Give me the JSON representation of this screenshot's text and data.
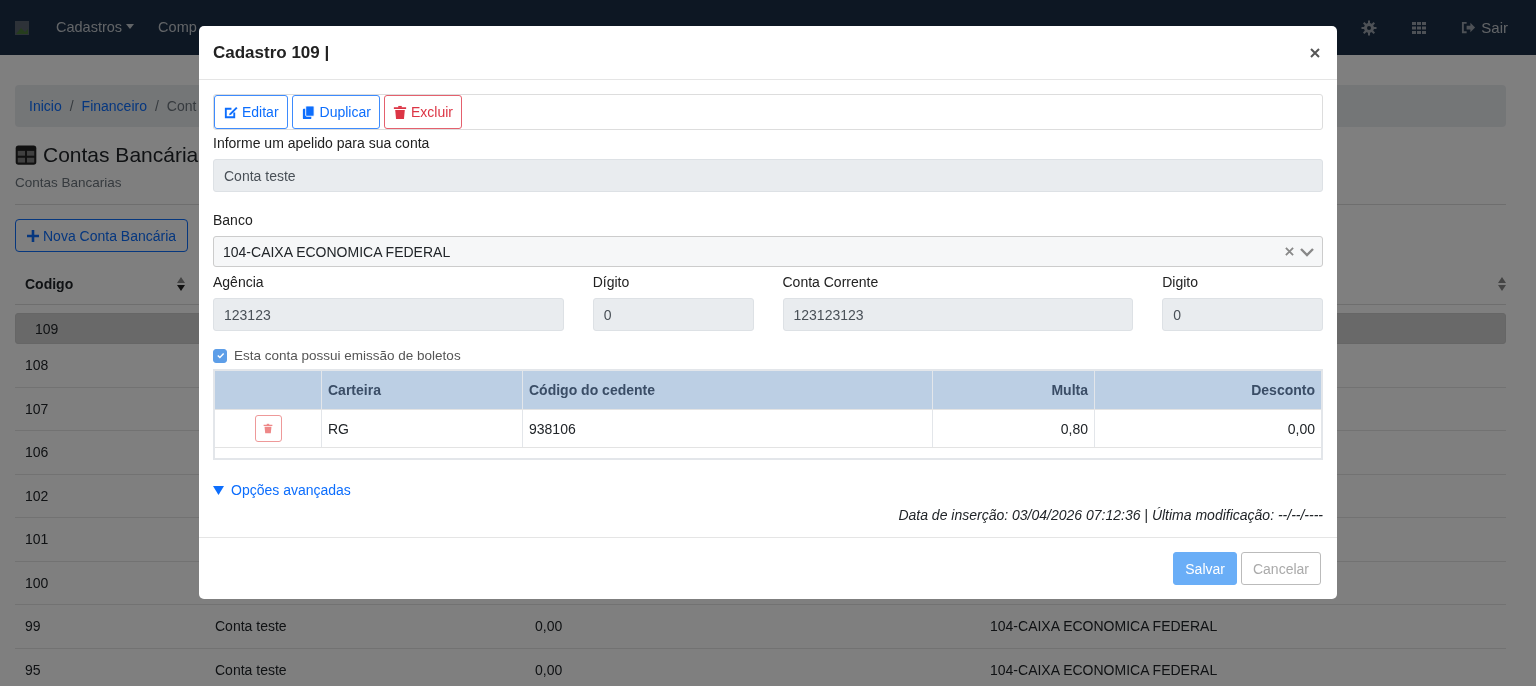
{
  "navbar": {
    "menus": [
      {
        "label": "Cadastros",
        "dropdown": true
      },
      {
        "label": "Comp",
        "dropdown": false
      }
    ],
    "logout": "Sair"
  },
  "breadcrumb": {
    "separator": "/",
    "items": [
      "Inicio",
      "Financeiro",
      "Cont"
    ]
  },
  "page": {
    "title": "Contas Bancária",
    "subtitle": "Contas Bancarias",
    "new_button": "Nova Conta Bancária"
  },
  "table": {
    "columns": [
      "Codigo"
    ],
    "rows": [
      {
        "cells": [
          "109"
        ],
        "selected": true
      },
      {
        "cells": [
          "108"
        ],
        "selected": false
      },
      {
        "cells": [
          "107"
        ],
        "selected": false
      },
      {
        "cells": [
          "106"
        ],
        "selected": false
      },
      {
        "cells": [
          "102"
        ],
        "selected": false
      },
      {
        "cells": [
          "101"
        ],
        "selected": false
      },
      {
        "cells": [
          "100"
        ],
        "selected": false
      },
      {
        "cells": [
          "99",
          "Conta teste",
          "0,00",
          "104-CAIXA ECONOMICA FEDERAL"
        ],
        "selected": false
      },
      {
        "cells": [
          "95",
          "Conta teste",
          "0,00",
          "104-CAIXA ECONOMICA FEDERAL"
        ],
        "selected": false
      }
    ]
  },
  "modal": {
    "title": "Cadastro 109 |",
    "actions": [
      {
        "label": "Editar",
        "kind": "edit"
      },
      {
        "label": "Duplicar",
        "kind": "copy"
      },
      {
        "label": "Excluir",
        "kind": "delete"
      }
    ],
    "nickname": {
      "label": "Informe um apelido para sua conta",
      "value": "Conta teste"
    },
    "bank": {
      "label": "Banco",
      "value": "104-CAIXA ECONOMICA FEDERAL"
    },
    "fields": [
      {
        "label": "Agência",
        "value": "123123"
      },
      {
        "label": "Dígito",
        "value": "0"
      },
      {
        "label": "Conta Corrente",
        "value": "123123123"
      },
      {
        "label": "Digito",
        "value": "0"
      }
    ],
    "boleto": {
      "label": "Esta conta possui emissão de boletos",
      "checked": true
    },
    "boleto_table": {
      "columns": [
        "Carteira",
        "Código do cedente",
        "Multa",
        "Desconto"
      ],
      "rows": [
        {
          "cells": [
            "RG",
            "938106",
            "0,80",
            "0,00"
          ]
        }
      ]
    },
    "advanced": {
      "label": "Opções avançadas",
      "expanded": false
    },
    "timestamps": "Data de inserção: 03/04/2026 07:12:36 | Última modificação: --/--/----",
    "buttons": [
      {
        "label": "Salvar",
        "kind": "primary"
      },
      {
        "label": "Cancelar",
        "kind": "secondary"
      }
    ]
  }
}
